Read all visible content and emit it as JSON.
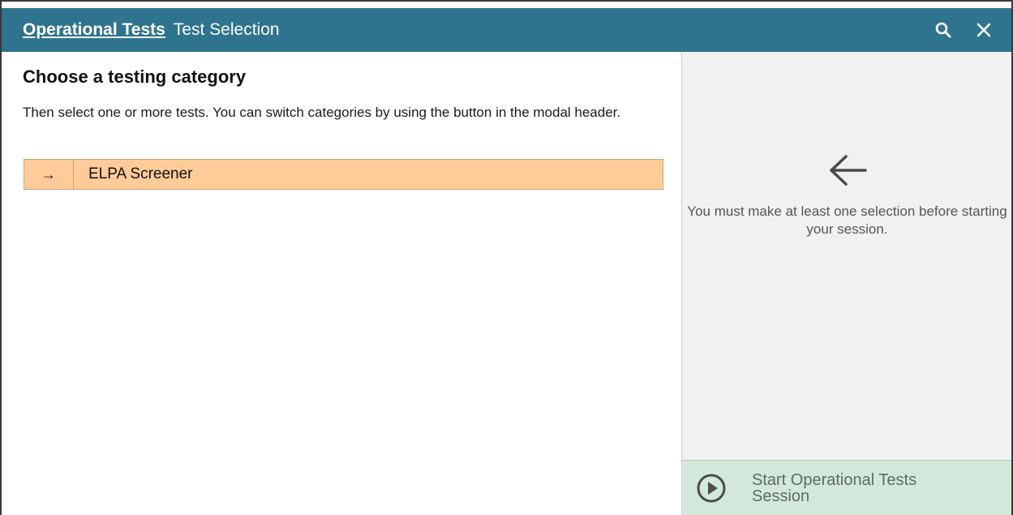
{
  "header": {
    "link_label": "Operational Tests",
    "title": "Test Selection",
    "search_icon": "search-icon",
    "close_icon": "close-icon"
  },
  "main": {
    "heading": "Choose a testing category",
    "description": "Then select one or more tests. You can switch categories by using the button in the modal header.",
    "categories": [
      {
        "arrow": "→",
        "label": "ELPA Screener"
      }
    ]
  },
  "sidebar": {
    "hint": "You must make at least one selection before starting your session.",
    "start_button_label": "Start Operational Tests Session"
  },
  "colors": {
    "header_bg": "#2f748e",
    "category_bg": "#ffcc99",
    "sidebar_bg": "#f1f1f1",
    "start_button_bg": "#d3e8da"
  }
}
